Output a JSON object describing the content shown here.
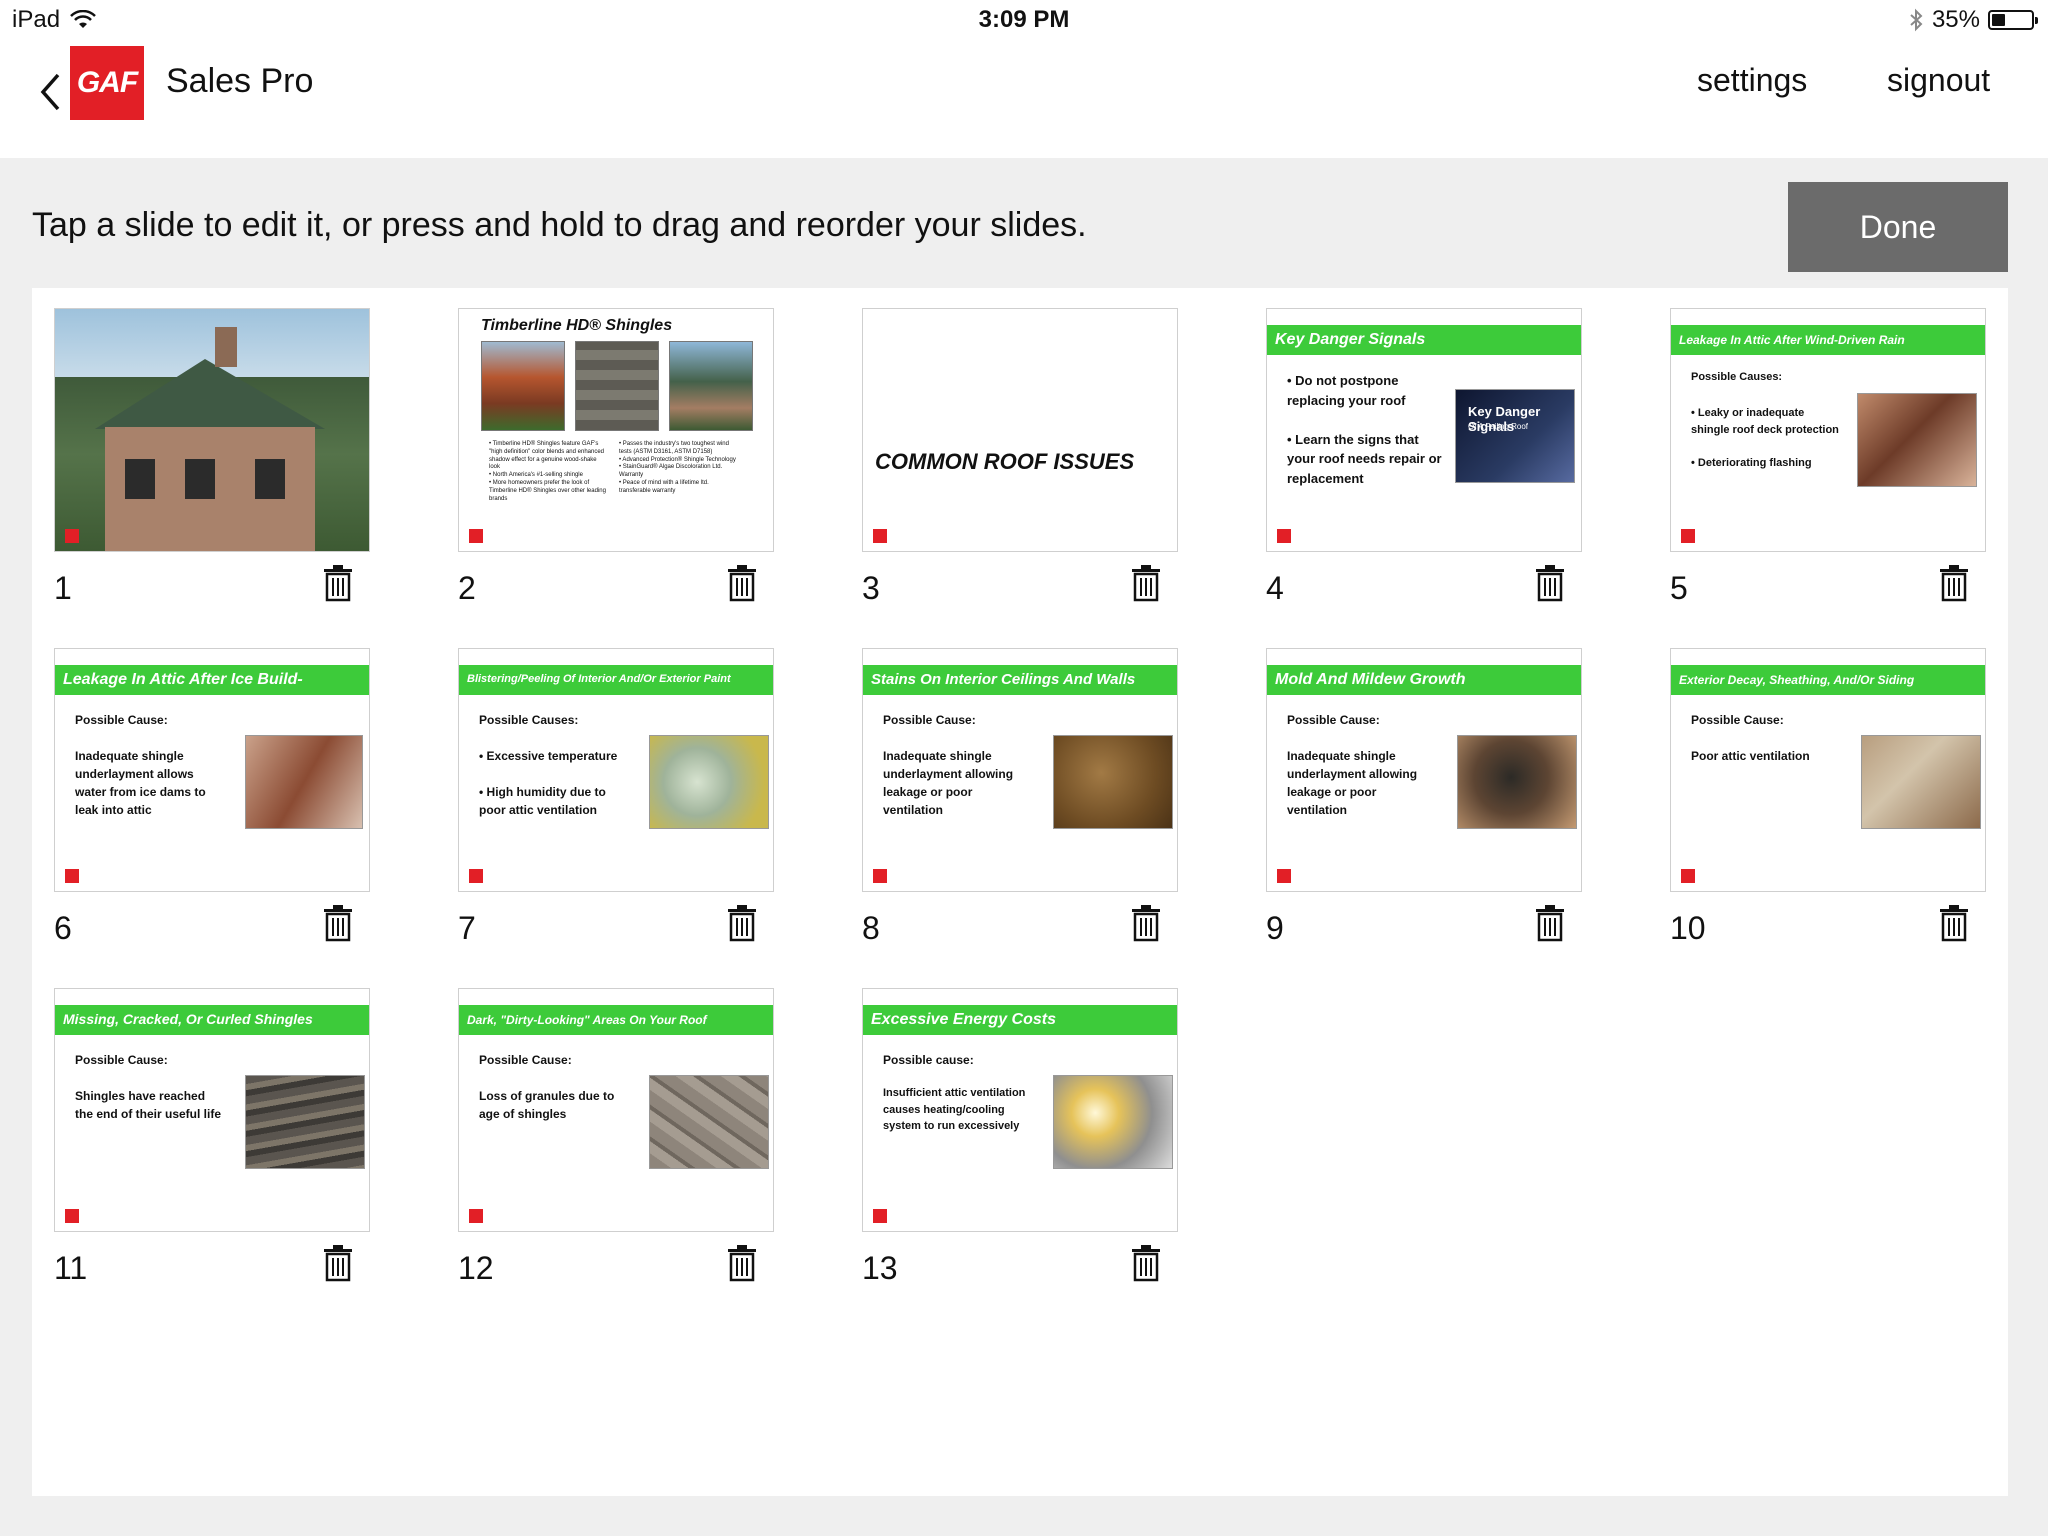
{
  "status": {
    "device": "iPad",
    "time": "3:09 PM",
    "battery": "35%",
    "battery_level": 0.35
  },
  "nav": {
    "logo": "GAF",
    "title": "Sales Pro",
    "settings": "settings",
    "signout": "signout"
  },
  "instruction": "Tap a slide to edit it, or press and hold to drag and reorder your slides.",
  "done_label": "Done",
  "slides": [
    {
      "num": "1"
    },
    {
      "num": "2",
      "title": "Timberline HD® Shingles",
      "col1": "• Timberline HD® Shingles feature GAF's \"high definition\" color blends and enhanced shadow effect for a genuine wood-shake look\n• North America's #1-selling shingle\n• More homeowners prefer the look of Timberline HD® Shingles over other leading brands",
      "col2": "• Passes the industry's two toughest wind tests (ASTM D3161, ASTM D7158)\n• Advanced Protection® Shingle Technology\n• StainGuard® Algae Discoloration Ltd. Warranty\n• Peace of mind with a lifetime ltd. transferable warranty"
    },
    {
      "num": "3",
      "title": "COMMON ROOF ISSUES"
    },
    {
      "num": "4",
      "title": "Key Danger Signals",
      "body": "• Do not postpone replacing your roof\n\n• Learn the signs that your roof needs repair or replacement",
      "pic_title": "Key Danger Signals",
      "pic_sub": "Of A Failing Roof"
    },
    {
      "num": "5",
      "title": "Leakage In Attic After Wind-Driven Rain",
      "sub": "Possible Causes:",
      "body": "• Leaky or inadequate shingle roof deck protection\n\n• Deteriorating flashing"
    },
    {
      "num": "6",
      "title": "Leakage In Attic After Ice Build-",
      "sub": "Possible Cause:",
      "body": "Inadequate shingle underlayment allows water from ice dams to leak into attic"
    },
    {
      "num": "7",
      "title": "Blistering/Peeling Of Interior And/Or Exterior Paint",
      "sub": "Possible Causes:",
      "body": "• Excessive temperature\n\n• High humidity due to poor attic ventilation"
    },
    {
      "num": "8",
      "title": "Stains On Interior Ceilings And Walls",
      "sub": "Possible Cause:",
      "body": "Inadequate shingle underlayment allowing leakage or poor ventilation"
    },
    {
      "num": "9",
      "title": "Mold And Mildew Growth",
      "sub": "Possible Cause:",
      "body": "Inadequate shingle underlayment allowing leakage or poor ventilation"
    },
    {
      "num": "10",
      "title": "Exterior Decay, Sheathing, And/Or Siding",
      "sub": "Possible Cause:",
      "body": "Poor attic ventilation"
    },
    {
      "num": "11",
      "title": "Missing, Cracked, Or Curled Shingles",
      "sub": "Possible Cause:",
      "body": "Shingles have reached the end of their useful life"
    },
    {
      "num": "12",
      "title": "Dark, \"Dirty-Looking\" Areas On Your Roof",
      "sub": "Possible Cause:",
      "body": "Loss of granules due to age of shingles"
    },
    {
      "num": "13",
      "title": "Excessive Energy Costs",
      "sub": "Possible cause:",
      "body": "Insufficient attic ventilation causes heating/cooling system to run excessively"
    }
  ],
  "colors": {
    "accent_green": "#3dcb3a",
    "gaf_red": "#e21f26",
    "done_gray": "#6b6b6b"
  }
}
